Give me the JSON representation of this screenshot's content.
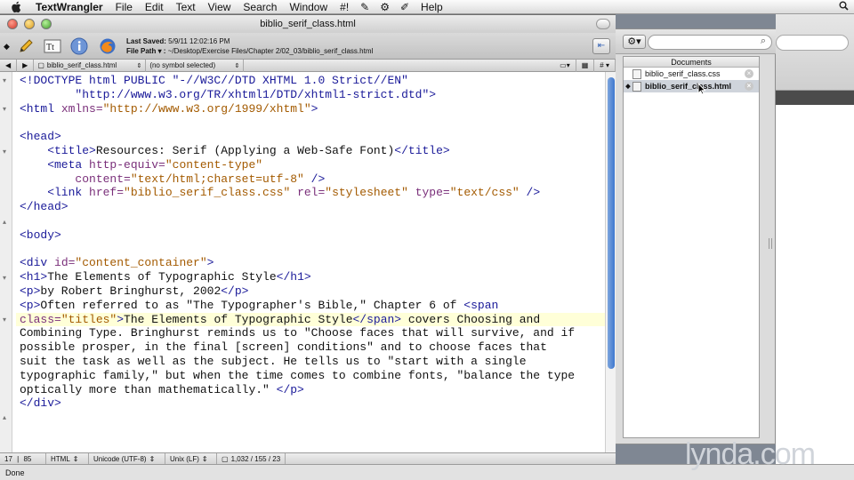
{
  "menubar": {
    "app_name": "TextWrangler",
    "items": [
      "File",
      "Edit",
      "Text",
      "View",
      "Search",
      "Window",
      "#!"
    ],
    "help": "Help",
    "icons": [
      "apple-icon",
      "script-icon",
      "gear-icon",
      "pencil-icon",
      "spotlight-icon"
    ]
  },
  "window": {
    "title": "biblio_serif_class.html"
  },
  "toolbar": {
    "last_saved_label": "Last Saved:",
    "last_saved_value": "5/9/11 12:02:16 PM",
    "file_path_label": "File Path ▾ :",
    "file_path_value": "~/Desktop/Exercise Files/Chapter 2/02_03/biblio_serif_class.html"
  },
  "navbar": {
    "file": "biblio_serif_class.html",
    "symbol": "(no symbol selected)",
    "hash": "#"
  },
  "drawer": {
    "header": "Documents",
    "docs": [
      {
        "name": "biblio_serif_class.css",
        "selected": false
      },
      {
        "name": "biblio_serif_class.html",
        "selected": true
      }
    ]
  },
  "code_lines": [
    [
      [
        "t",
        "<!DOCTYPE html PUBLIC \"-//W3C//DTD XHTML 1.0 Strict//EN\""
      ]
    ],
    [
      [
        "t",
        "        \"http://www.w3.org/TR/xhtml1/DTD/xhtml1-strict.dtd\">"
      ]
    ],
    [
      [
        "t",
        "<html "
      ],
      [
        "a",
        "xmlns="
      ],
      [
        "s",
        "\"http://www.w3.org/1999/xhtml\""
      ],
      [
        "t",
        ">"
      ]
    ],
    [
      [
        "c",
        ""
      ]
    ],
    [
      [
        "t",
        "<head>"
      ]
    ],
    [
      [
        "t",
        "    <title>"
      ],
      [
        "c",
        "Resources: Serif (Applying a Web-Safe Font)"
      ],
      [
        "t",
        "</title>"
      ]
    ],
    [
      [
        "t",
        "    <meta "
      ],
      [
        "a",
        "http-equiv="
      ],
      [
        "s",
        "\"content-type\""
      ]
    ],
    [
      [
        "a",
        "        content="
      ],
      [
        "s",
        "\"text/html;charset=utf-8\""
      ],
      [
        "t",
        " />"
      ]
    ],
    [
      [
        "t",
        "    <link "
      ],
      [
        "a",
        "href="
      ],
      [
        "s",
        "\"biblio_serif_class.css\""
      ],
      [
        "a",
        " rel="
      ],
      [
        "s",
        "\"stylesheet\""
      ],
      [
        "a",
        " type="
      ],
      [
        "s",
        "\"text/css\""
      ],
      [
        "t",
        " />"
      ]
    ],
    [
      [
        "t",
        "</head>"
      ]
    ],
    [
      [
        "c",
        ""
      ]
    ],
    [
      [
        "t",
        "<body>"
      ]
    ],
    [
      [
        "c",
        ""
      ]
    ],
    [
      [
        "t",
        "<div "
      ],
      [
        "a",
        "id="
      ],
      [
        "s",
        "\"content_container\""
      ],
      [
        "t",
        ">"
      ]
    ],
    [
      [
        "t",
        "<h1>"
      ],
      [
        "c",
        "The Elements of Typographic Style"
      ],
      [
        "t",
        "</h1>"
      ]
    ],
    [
      [
        "t",
        "<p>"
      ],
      [
        "c",
        "by Robert Bringhurst, 2002"
      ],
      [
        "t",
        "</p>"
      ]
    ],
    [
      [
        "t",
        "<p>"
      ],
      [
        "c",
        "Often referred to as \"The Typographer's Bible,\" Chapter 6 of "
      ],
      [
        "t",
        "<span"
      ]
    ],
    [
      [
        "a",
        "class="
      ],
      [
        "s",
        "\"titles\""
      ],
      [
        "t",
        ">"
      ],
      [
        "c",
        "The Elements of Typographic Style"
      ],
      [
        "t",
        "</span>"
      ],
      [
        "c",
        " covers Choosing and"
      ]
    ],
    [
      [
        "c",
        "Combining Type. Bringhurst reminds us to \"Choose faces that will survive, and if"
      ]
    ],
    [
      [
        "c",
        "possible prosper, in the final [screen] conditions\" and to choose faces that"
      ]
    ],
    [
      [
        "c",
        "suit the task as well as the subject. He tells us to \"start with a single"
      ]
    ],
    [
      [
        "c",
        "typographic family,\" but when the time comes to combine fonts, \"balance the type"
      ]
    ],
    [
      [
        "c",
        "optically more than mathematically.\" "
      ],
      [
        "t",
        "</p>"
      ]
    ],
    [
      [
        "t",
        "</div>"
      ]
    ]
  ],
  "highlight_line": 18,
  "status": {
    "line": "17",
    "col": "85",
    "language": "HTML",
    "encoding": "Unicode (UTF-8)",
    "line_endings": "Unix (LF)",
    "counts": "1,032 / 155 / 23"
  },
  "bottombar": {
    "text": "Done"
  },
  "watermark": "lynda.com"
}
